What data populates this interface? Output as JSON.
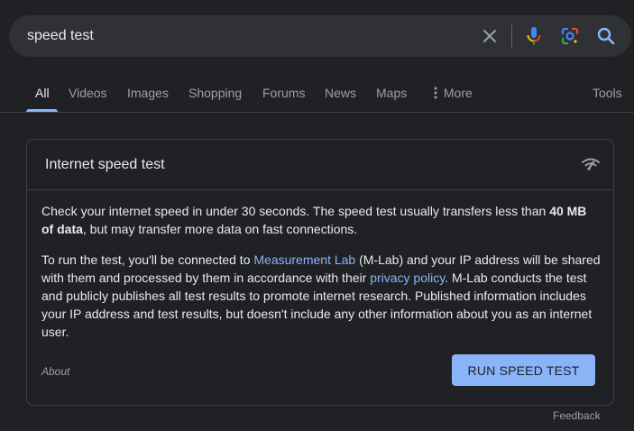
{
  "search": {
    "query": "speed test",
    "clear_icon": "close-icon",
    "voice_icon": "microphone-icon",
    "lens_icon": "camera-lens-icon",
    "search_icon": "search-icon"
  },
  "tabs": [
    {
      "label": "All",
      "active": true
    },
    {
      "label": "Videos"
    },
    {
      "label": "Images"
    },
    {
      "label": "Shopping"
    },
    {
      "label": "Forums"
    },
    {
      "label": "News"
    },
    {
      "label": "Maps"
    },
    {
      "label": "More",
      "icon": "more-vert-icon"
    },
    {
      "label": "Tools"
    }
  ],
  "card": {
    "title": "Internet speed test",
    "title_icon": "wifi-signal-icon",
    "para1_before": "Check your internet speed in under 30 seconds. The speed test usually transfers less than ",
    "para1_bold": "40 MB of data",
    "para1_after": ", but may transfer more data on fast connections.",
    "para2_part1": "To run the test, you'll be connected to ",
    "para2_link1": "Measurement Lab",
    "para2_part2": " (M-Lab) and your IP address will be shared with them and processed by them in accordance with their ",
    "para2_link2": "privacy policy",
    "para2_part3": ". M-Lab conducts the test and publicly publishes all test results to promote internet research. Published information includes your IP address and test results, but doesn't include any other information about you as an internet user.",
    "about": "About",
    "button": "RUN SPEED TEST"
  },
  "footer": {
    "feedback": "Feedback"
  },
  "colors": {
    "background": "#202124",
    "surface": "#303134",
    "accent": "#8ab4f8",
    "text": "#e8eaed",
    "muted": "#9aa0a6",
    "border": "#3c4043"
  }
}
